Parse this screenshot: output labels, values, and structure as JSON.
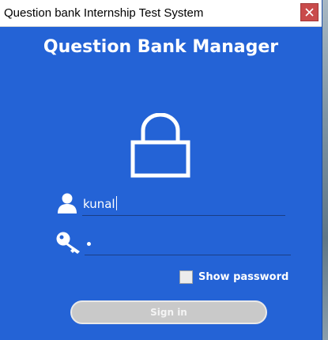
{
  "window": {
    "title": "Question bank Internship Test System"
  },
  "heading": "Question Bank Manager",
  "login": {
    "username_value": "kunal",
    "show_password_label": "Show password",
    "show_password_checked": false,
    "sign_in_label": "Sign in"
  },
  "icons": {
    "close": "close-icon",
    "lock": "lock-icon",
    "user": "user-icon",
    "key": "key-icon"
  },
  "colors": {
    "background": "#2463d6",
    "close_button": "#c94b4b",
    "button_disabled": "#c9c9c9",
    "text": "#ffffff"
  }
}
